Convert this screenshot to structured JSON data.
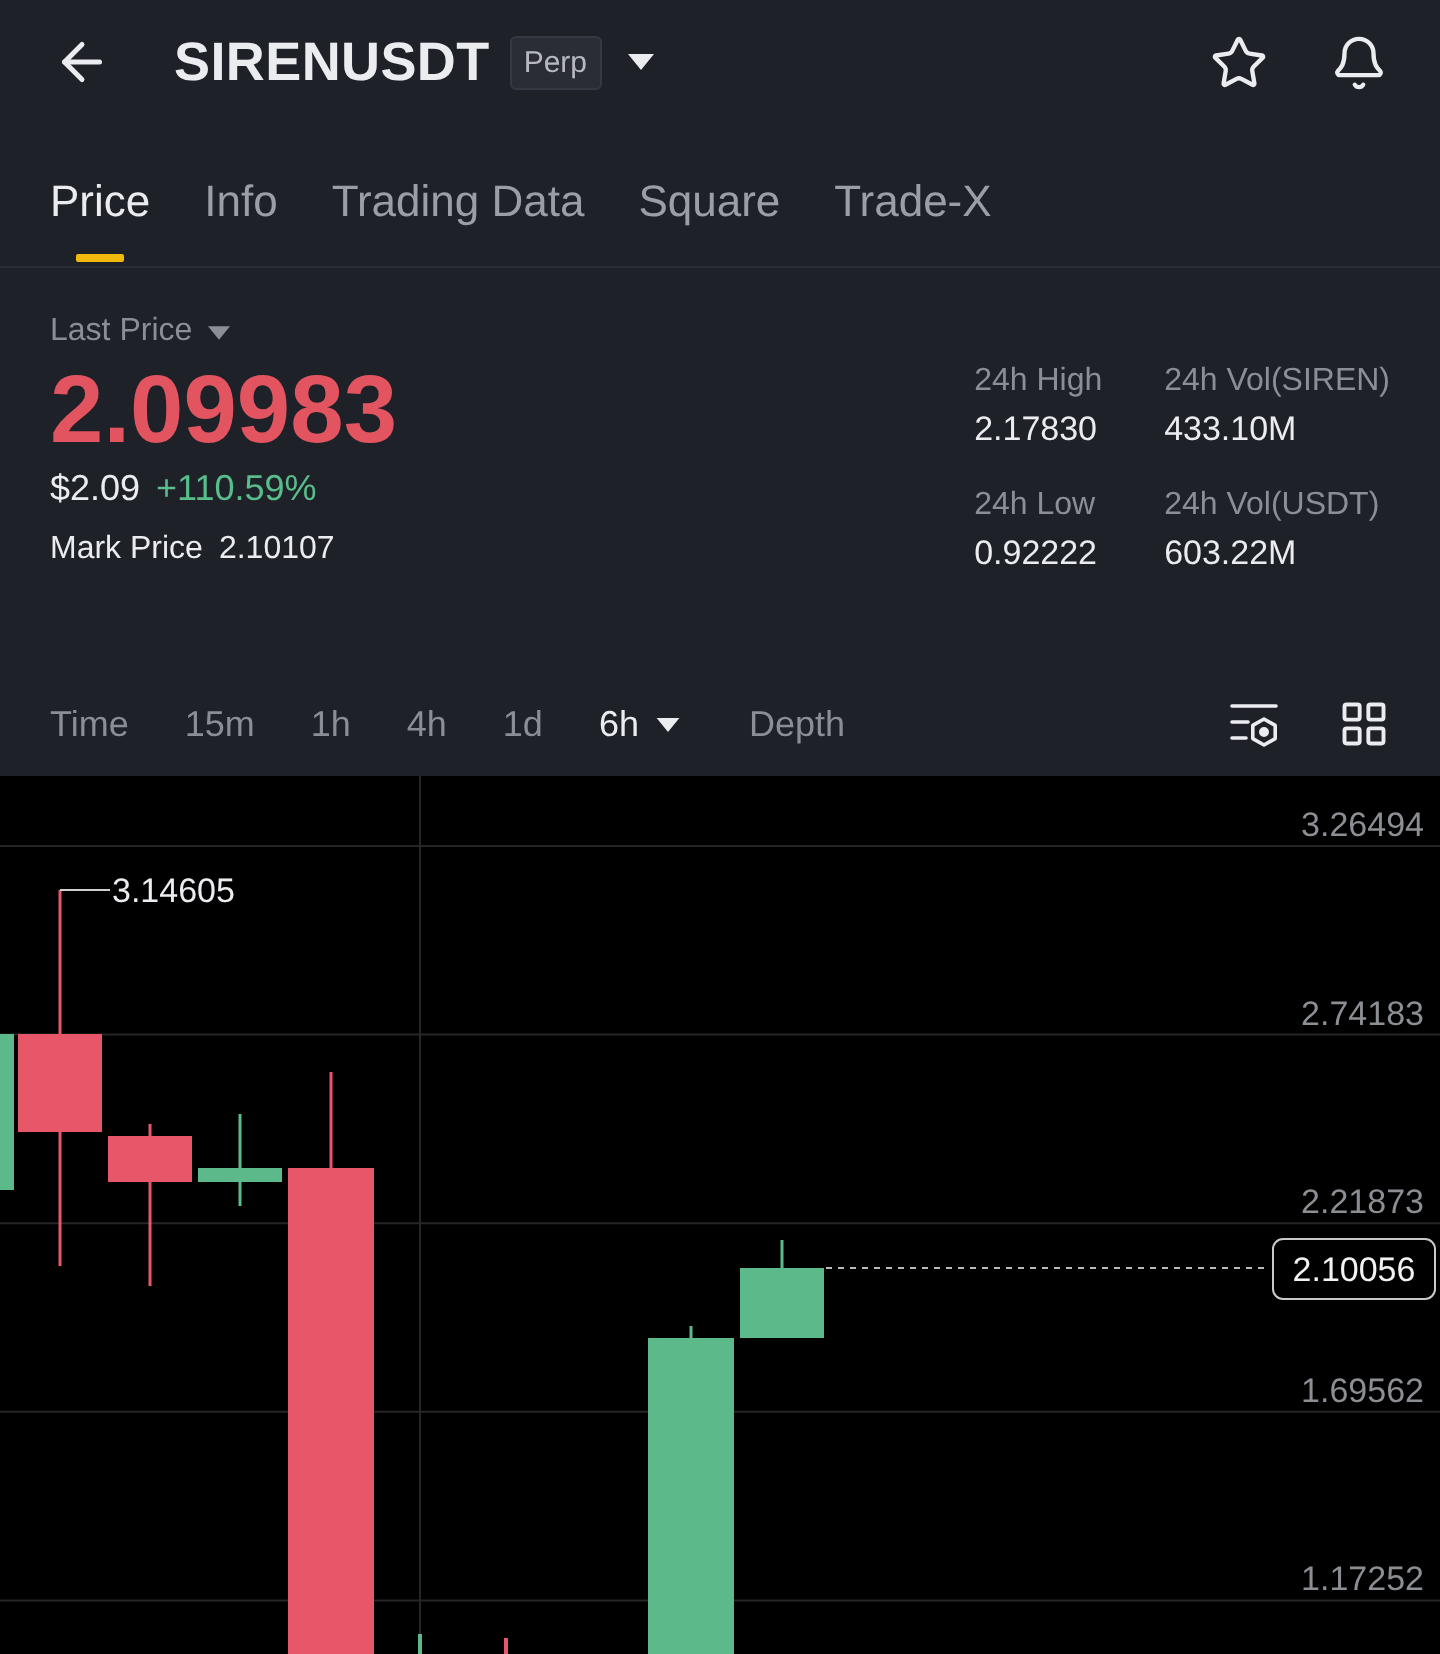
{
  "header": {
    "title": "SIRENUSDT",
    "badge": "Perp"
  },
  "tabs": [
    {
      "label": "Price",
      "selected": true
    },
    {
      "label": "Info",
      "selected": false
    },
    {
      "label": "Trading Data",
      "selected": false
    },
    {
      "label": "Square",
      "selected": false
    },
    {
      "label": "Trade-X",
      "selected": false
    }
  ],
  "ticker": {
    "last_price_label": "Last Price",
    "last_price": "2.09983",
    "usd_price": "$2.09",
    "change": "+110.59%",
    "mark_price_label": "Mark Price",
    "mark_price": "2.10107"
  },
  "stats": [
    {
      "label": "24h High",
      "value": "2.17830"
    },
    {
      "label": "24h Vol(SIREN)",
      "value": "433.10M"
    },
    {
      "label": "24h Low",
      "value": "0.92222"
    },
    {
      "label": "24h Vol(USDT)",
      "value": "603.22M"
    }
  ],
  "intervals": [
    {
      "label": "Time",
      "selected": false,
      "kind": "plain"
    },
    {
      "label": "15m",
      "selected": false,
      "kind": "plain"
    },
    {
      "label": "1h",
      "selected": false,
      "kind": "plain"
    },
    {
      "label": "4h",
      "selected": false,
      "kind": "plain"
    },
    {
      "label": "1d",
      "selected": false,
      "kind": "plain"
    },
    {
      "label": "6h",
      "selected": true,
      "kind": "dropdown"
    },
    {
      "label": "Depth",
      "selected": false,
      "kind": "plain"
    }
  ],
  "chart": {
    "price_axis": [
      "3.26494",
      "2.74183",
      "2.21873",
      "1.69562",
      "1.17252"
    ],
    "high_marker": "3.14605",
    "current_price": "2.10056"
  }
}
